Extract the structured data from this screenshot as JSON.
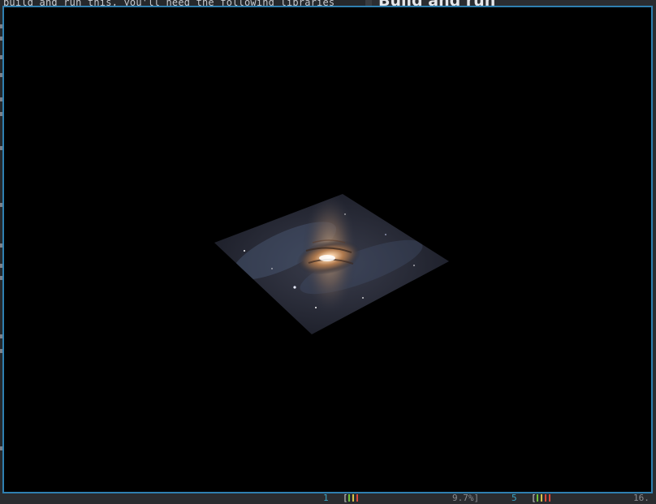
{
  "background_editor": {
    "visible_line": "build and run this, you'll need the following libraries"
  },
  "background_doc": {
    "heading": "Build and run"
  },
  "status_bar": {
    "cpu1": {
      "label": "1",
      "percent_text": "9.7%]"
    },
    "cpu5": {
      "label": "5",
      "percent_text": "16."
    }
  },
  "gl_window": {
    "content": "galaxy-textured-quad",
    "background_color": "#000000",
    "border_color": "#2f7fb0"
  },
  "colors": {
    "accent": "#2f7fb0",
    "cpu_label": "#3aa3c4",
    "bar_green": "#6fbf3a",
    "bar_red": "#d9483b",
    "bar_yellow": "#d8c14a"
  }
}
